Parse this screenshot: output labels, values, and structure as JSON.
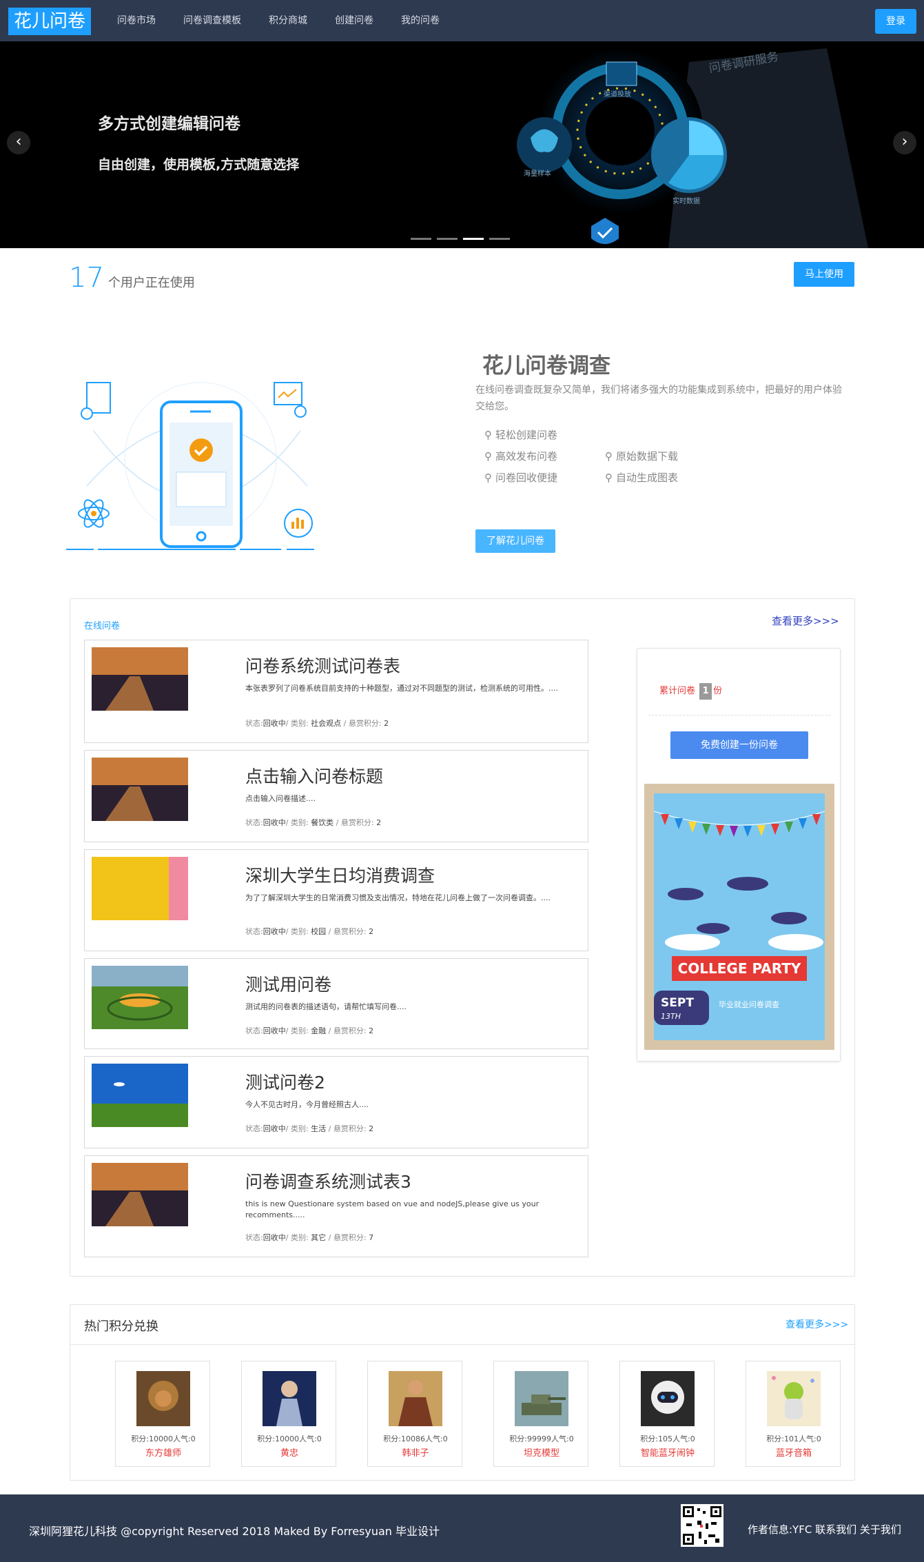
{
  "nav": {
    "logo": "花儿问卷",
    "items": [
      "问卷市场",
      "问卷调查模板",
      "积分商城",
      "创建问卷",
      "我的问卷"
    ],
    "login": "登录"
  },
  "banner": {
    "title": "多方式创建编辑问卷",
    "subtitle": "自由创建，使用模板,方式随意选择",
    "prev": "‹",
    "next": "›",
    "art_text": [
      "问卷调研服务",
      "渠道投放",
      "海量样本",
      "实时数据"
    ],
    "slides": 4,
    "active_slide": 3
  },
  "stats": {
    "count": "17",
    "label": "个用户正在使用",
    "button": "马上使用"
  },
  "intro": {
    "title": "花儿问卷调查",
    "desc": "在线问卷调查既复杂又简单，我们将诸多强大的功能集成到系统中，把最好的用户体验交给您。",
    "features": [
      "轻松创建问卷",
      "高效发布问卷",
      "原始数据下载",
      "问卷回收便捷",
      "自动生成图表"
    ],
    "button": "了解花儿问卷"
  },
  "questionnaires": {
    "label": "在线问卷",
    "more": "查看更多>>>",
    "meta_labels": {
      "status": "状态:",
      "category": "/ 类别:",
      "points": "/ 悬赏积分:"
    },
    "items": [
      {
        "title": "问卷系统测试问卷表",
        "desc": "本张表罗列了问卷系统目前支持的十种题型，通过对不同题型的测试，检测系统的可用性。....",
        "status": "回收中",
        "category": "社会观点",
        "points": "2"
      },
      {
        "title": "点击输入问卷标题",
        "desc": "点击输入问卷描述....",
        "status": "回收中",
        "category": "餐饮类",
        "points": "2"
      },
      {
        "title": "深圳大学生日均消费调查",
        "desc": "为了了解深圳大学生的日常消费习惯及支出情况，特地在花儿问卷上做了一次问卷调查。....",
        "status": "回收中",
        "category": "校园",
        "points": "2"
      },
      {
        "title": "测试用问卷",
        "desc": "测试用的问卷表的描述语句，请帮忙填写问卷....",
        "status": "回收中",
        "category": "金融",
        "points": "2"
      },
      {
        "title": "测试问卷2",
        "desc": "今人不见古时月，今月曾经照古人....",
        "status": "回收中",
        "category": "生活",
        "points": "2"
      },
      {
        "title": "问卷调查系统测试表3",
        "desc": "this is new Questionare system based on vue and nodeJS,please give us your recomments.....",
        "status": "回收中",
        "category": "其它",
        "points": "7"
      }
    ]
  },
  "sidebar": {
    "count_label": "累计问卷",
    "count": "1",
    "unit": "份",
    "button": "免费创建一份问卷",
    "poster": {
      "headline": "COLLEGE PARTY",
      "date": "SEPT",
      "day": "13TH",
      "caption": "毕业就业问卷调查"
    }
  },
  "hot": {
    "title": "热门积分兑换",
    "more": "查看更多>>>",
    "products": [
      {
        "meta": "积分:10000人气:0",
        "name": "东方雄师",
        "color": "#b07a3a"
      },
      {
        "meta": "积分:10000人气:0",
        "name": "黄忠",
        "color": "#3a4a8a"
      },
      {
        "meta": "积分:10086人气:0",
        "name": "韩非子",
        "color": "#7a3a22"
      },
      {
        "meta": "积分:99999人气:0",
        "name": "坦克模型",
        "color": "#6a7a5a"
      },
      {
        "meta": "积分:105人气:0",
        "name": "智能蓝牙闹钟",
        "color": "#444"
      },
      {
        "meta": "积分:101人气:0",
        "name": "蓝牙音箱",
        "color": "#d8c070"
      }
    ]
  },
  "footer": {
    "left": "深圳阿狸花儿科技 @copyright Reserved 2018 Maked By Forresyuan 毕业设计",
    "right": "作者信息:YFC 联系我们 关于我们"
  }
}
